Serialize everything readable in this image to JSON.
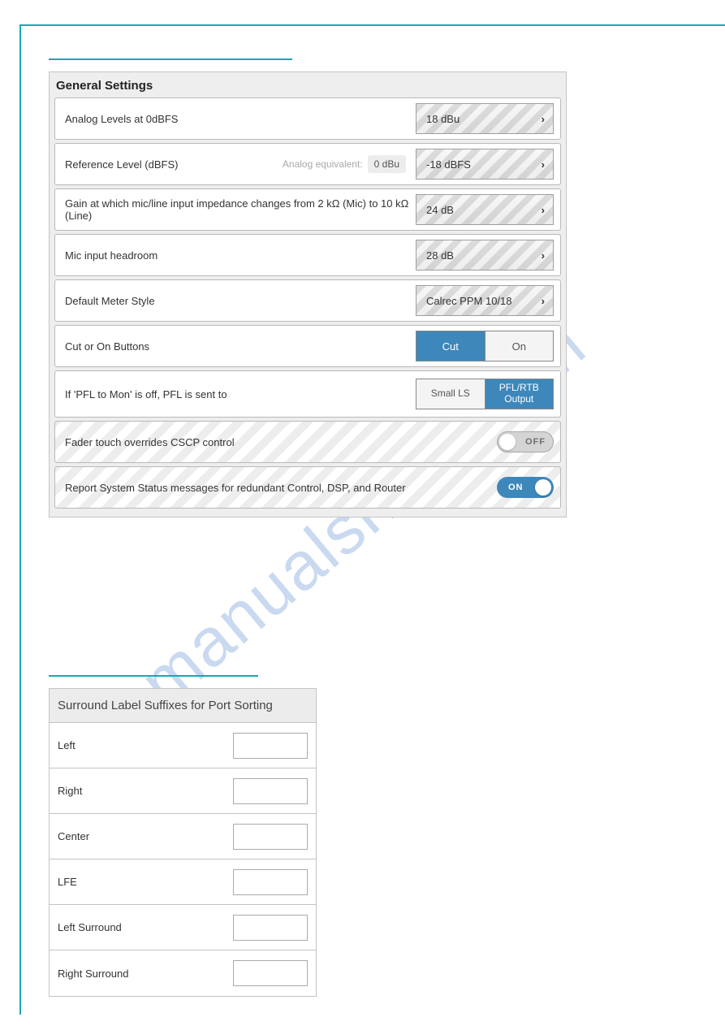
{
  "watermark": "manualshive.com",
  "general": {
    "title": "General Settings",
    "rows": {
      "analog_levels": {
        "label": "Analog Levels at 0dBFS",
        "value": "18 dBu"
      },
      "ref_level": {
        "label": "Reference Level (dBFS)",
        "analog_eq_label": "Analog equivalent:",
        "analog_eq_value": "0 dBu",
        "value": "-18 dBFS"
      },
      "gain_impedance": {
        "label": "Gain at which mic/line input impedance changes from 2 kΩ (Mic) to 10 kΩ (Line)",
        "value": "24 dB"
      },
      "mic_headroom": {
        "label": "Mic input headroom",
        "value": "28 dB"
      },
      "meter_style": {
        "label": "Default Meter Style",
        "value": "Calrec PPM 10/18"
      },
      "cut_on": {
        "label": "Cut or On Buttons",
        "opt_a": "Cut",
        "opt_b": "On"
      },
      "pfl": {
        "label": "If 'PFL to Mon' is off, PFL is sent to",
        "opt_a": "Small LS",
        "opt_b": "PFL/RTB Output"
      },
      "fader_cscp": {
        "label": "Fader touch overrides CSCP control",
        "state": "OFF"
      },
      "report_status": {
        "label": "Report System Status messages for redundant Control, DSP, and Router",
        "state": "ON"
      }
    }
  },
  "suffix": {
    "title": "Surround Label Suffixes for Port Sorting",
    "rows": [
      {
        "label": "Left"
      },
      {
        "label": "Right"
      },
      {
        "label": "Center"
      },
      {
        "label": "LFE"
      },
      {
        "label": "Left Surround"
      },
      {
        "label": "Right Surround"
      }
    ]
  }
}
